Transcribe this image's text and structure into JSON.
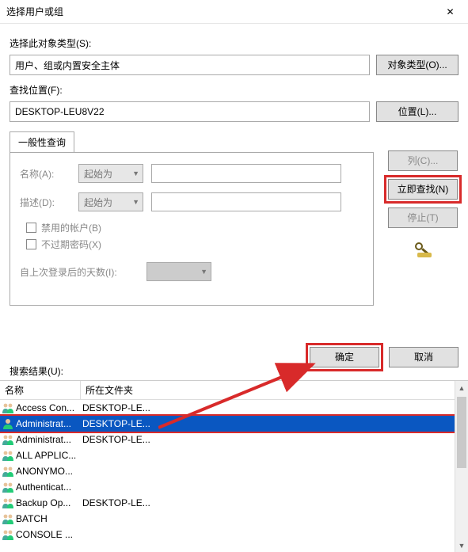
{
  "title": "选择用户或组",
  "sections": {
    "objectType": {
      "label": "选择此对象类型(S):",
      "value": "用户、组或内置安全主体",
      "button": "对象类型(O)..."
    },
    "location": {
      "label": "查找位置(F):",
      "value": "DESKTOP-LEU8V22",
      "button": "位置(L)..."
    }
  },
  "tab": "一般性查询",
  "form": {
    "nameLabel": "名称(A):",
    "descLabel": "描述(D):",
    "comboValue": "起始为",
    "chkDisabled": "禁用的帐户(B)",
    "chkNoExpire": "不过期密码(X)",
    "daysLabel": "自上次登录后的天数(I):"
  },
  "sideButtons": {
    "columns": "列(C)...",
    "findNow": "立即查找(N)",
    "stop": "停止(T)"
  },
  "dlg": {
    "ok": "确定",
    "cancel": "取消"
  },
  "results": {
    "label": "搜索结果(U):",
    "headers": {
      "name": "名称",
      "folder": "所在文件夹"
    },
    "items": [
      {
        "type": "group",
        "name": "Access Con...",
        "folder": "DESKTOP-LE..."
      },
      {
        "type": "user",
        "name": "Administrat...",
        "folder": "DESKTOP-LE...",
        "selected": true
      },
      {
        "type": "group",
        "name": "Administrat...",
        "folder": "DESKTOP-LE..."
      },
      {
        "type": "group",
        "name": "ALL APPLIC...",
        "folder": ""
      },
      {
        "type": "group",
        "name": "ANONYMO...",
        "folder": ""
      },
      {
        "type": "group",
        "name": "Authenticat...",
        "folder": ""
      },
      {
        "type": "group",
        "name": "Backup Op...",
        "folder": "DESKTOP-LE..."
      },
      {
        "type": "group",
        "name": "BATCH",
        "folder": ""
      },
      {
        "type": "group",
        "name": "CONSOLE ...",
        "folder": ""
      }
    ]
  }
}
